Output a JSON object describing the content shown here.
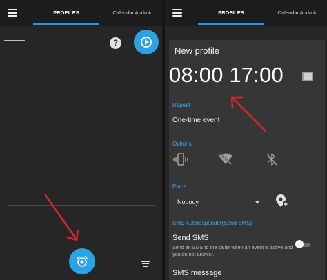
{
  "left": {
    "tabs": [
      {
        "label": "PROFILES",
        "active": true
      },
      {
        "label": "Calendar Android",
        "active": false
      }
    ],
    "icons": {
      "menu": "menu-icon",
      "help": "help-icon",
      "help_glyph": "?",
      "play": "play-icon",
      "add_alarm": "add-alarm-icon",
      "filter": "filter-icon"
    }
  },
  "right": {
    "tabs": [
      {
        "label": "PROFILES",
        "active": true
      },
      {
        "label": "Calendar Android",
        "active": false
      }
    ],
    "card": {
      "title": "New profile",
      "times": "08:00 17:00",
      "checkbox_checked": false,
      "repeat": {
        "label": "Repeat",
        "value": "One-time event"
      },
      "options": {
        "label": "Options",
        "icons": [
          "vibrate-icon",
          "wifi-off-icon",
          "bluetooth-off-icon"
        ]
      },
      "place": {
        "label": "Place",
        "value": "Nobody"
      },
      "sms_autoresponder": {
        "label": "SMS Autoresponder(Send SMS)",
        "send_sms_title": "Send SMS",
        "send_sms_desc": "Send an SMS to the caller when an event is active and you do not answer.",
        "toggle_on": false,
        "sms_message_title": "SMS message"
      }
    }
  },
  "colors": {
    "accent": "#29a3e4",
    "annotation_arrow": "#d9262c",
    "background": "#262626",
    "card": "#363636"
  }
}
